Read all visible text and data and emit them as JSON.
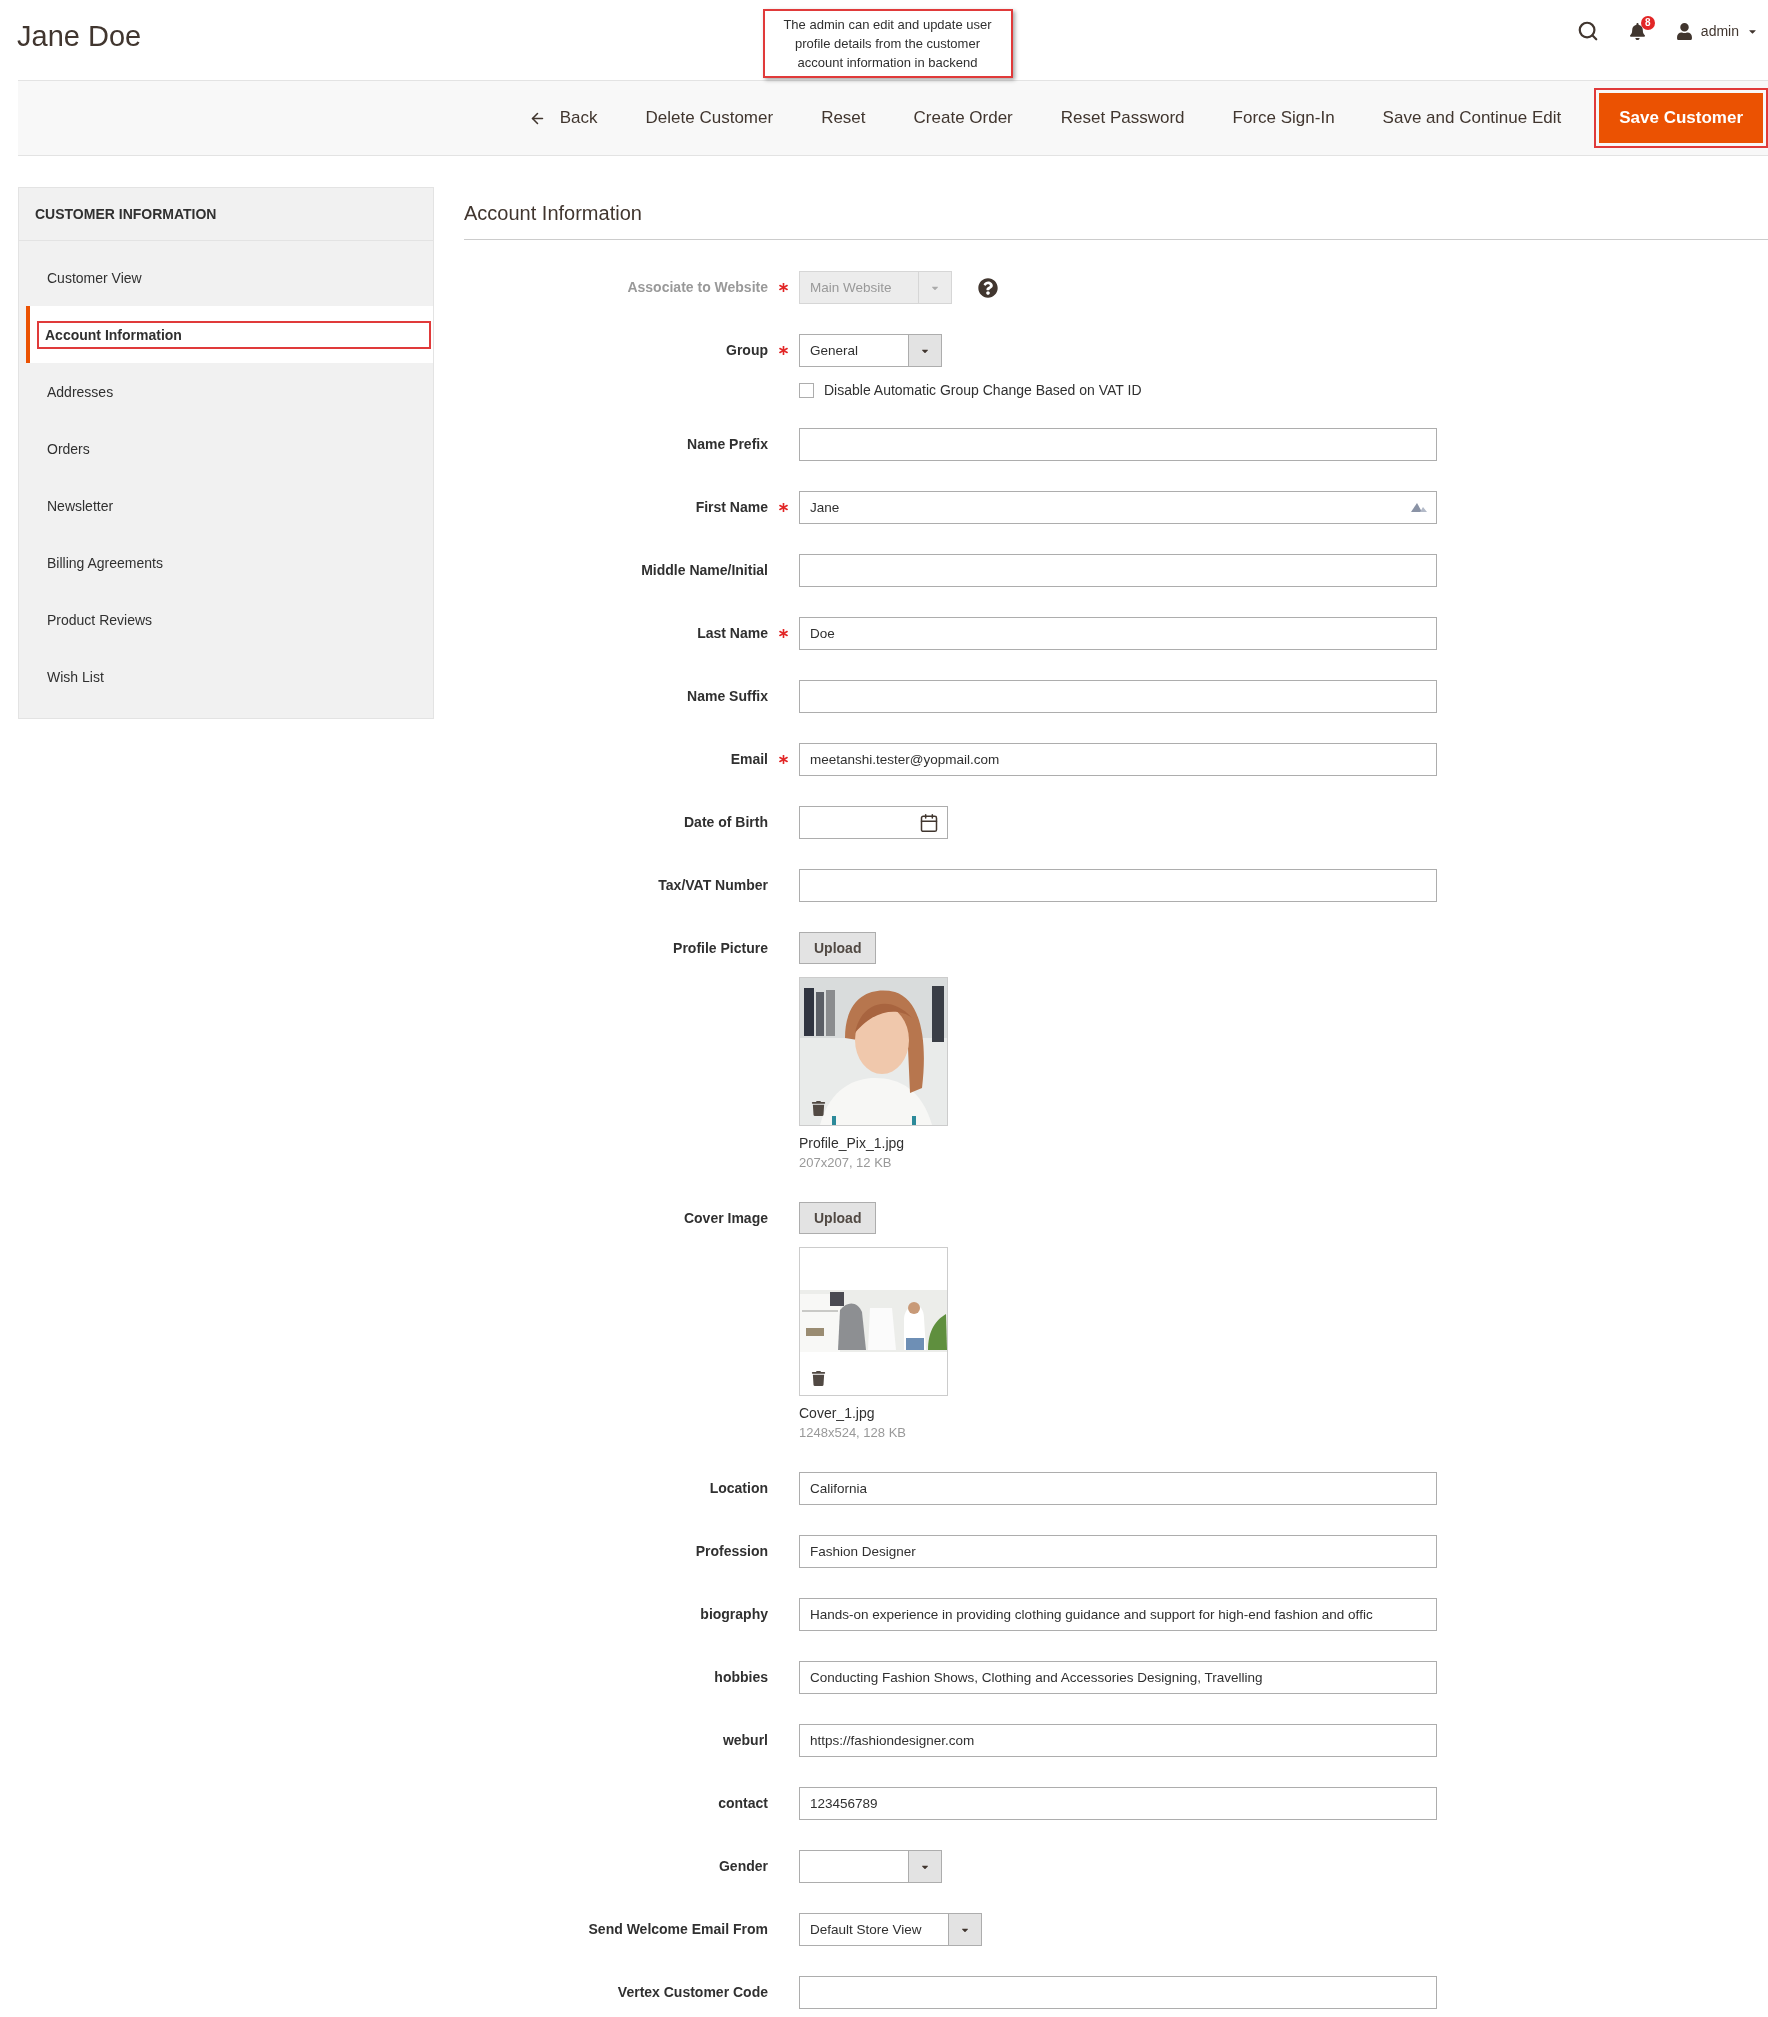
{
  "header": {
    "title": "Jane Doe",
    "annotation": "The admin can edit and update user profile details from the customer account information in backend",
    "notifications": "8",
    "user": "admin"
  },
  "toolbar": {
    "buttons": [
      {
        "label": "Back",
        "kind": "back",
        "annotated": false
      },
      {
        "label": "Delete Customer",
        "kind": "plain",
        "annotated": false
      },
      {
        "label": "Reset",
        "kind": "plain",
        "annotated": false
      },
      {
        "label": "Create Order",
        "kind": "plain",
        "annotated": false
      },
      {
        "label": "Reset Password",
        "kind": "plain",
        "annotated": false
      },
      {
        "label": "Force Sign-In",
        "kind": "plain",
        "annotated": false
      },
      {
        "label": "Save and Continue Edit",
        "kind": "plain",
        "annotated": false
      },
      {
        "label": "Save Customer",
        "kind": "primary",
        "annotated": true
      }
    ]
  },
  "sidebar": {
    "title": "CUSTOMER INFORMATION",
    "items": [
      {
        "label": "Customer View",
        "selected": false,
        "annotated": false
      },
      {
        "label": "Account Information",
        "selected": true,
        "annotated": true
      },
      {
        "label": "Addresses",
        "selected": false,
        "annotated": false
      },
      {
        "label": "Orders",
        "selected": false,
        "annotated": false
      },
      {
        "label": "Newsletter",
        "selected": false,
        "annotated": false
      },
      {
        "label": "Billing Agreements",
        "selected": false,
        "annotated": false
      },
      {
        "label": "Product Reviews",
        "selected": false,
        "annotated": false
      },
      {
        "label": "Wish List",
        "selected": false,
        "annotated": false
      }
    ]
  },
  "section": {
    "title": "Account Information"
  },
  "form": {
    "rows": [
      {
        "kind": "select",
        "label": "Associate to Website",
        "required": true,
        "disabled": true,
        "value": "Main Website",
        "help": true
      },
      {
        "kind": "select",
        "label": "Group",
        "required": true,
        "disabled": false,
        "value": "General",
        "help": false
      },
      {
        "kind": "checkbox",
        "label": "Disable Automatic Group Change Based on VAT ID",
        "checked": false
      },
      {
        "kind": "text",
        "label": "Name Prefix",
        "required": false,
        "autofill": false
      },
      {
        "kind": "text",
        "label": "First Name",
        "required": true,
        "value": "Jane",
        "autofill": true
      },
      {
        "kind": "text",
        "label": "Middle Name/Initial",
        "required": false,
        "autofill": false
      },
      {
        "kind": "text",
        "label": "Last Name",
        "required": true,
        "value": "Doe",
        "autofill": false
      },
      {
        "kind": "text",
        "label": "Name Suffix",
        "required": false,
        "autofill": false
      },
      {
        "kind": "text",
        "label": "Email",
        "required": true,
        "value": "meetanshi.tester@yopmail.com",
        "autofill": false
      },
      {
        "kind": "date",
        "label": "Date of Birth",
        "required": false
      },
      {
        "kind": "text",
        "label": "Tax/VAT Number",
        "required": false,
        "autofill": false
      },
      {
        "kind": "upload",
        "label": "Profile Picture",
        "button": "Upload",
        "file_name": "Profile_Pix_1.jpg",
        "file_size": "207x207, 12 KB"
      },
      {
        "kind": "upload",
        "label": "Cover Image",
        "button": "Upload",
        "file_name": "Cover_1.jpg",
        "file_size": "1248x524, 128 KB"
      },
      {
        "kind": "text",
        "label": "Location",
        "required": false,
        "value": "California",
        "autofill": false
      },
      {
        "kind": "text",
        "label": "Profession",
        "required": false,
        "value": "Fashion Designer",
        "autofill": false
      },
      {
        "kind": "text",
        "label": "biography",
        "required": false,
        "value": "Hands-on experience in providing clothing guidance and support for high-end fashion and offic",
        "autofill": false
      },
      {
        "kind": "text",
        "label": "hobbies",
        "required": false,
        "value": "Conducting Fashion Shows, Clothing and Accessories Designing, Travelling",
        "autofill": false
      },
      {
        "kind": "text",
        "label": "weburl",
        "required": false,
        "value": "https://fashiondesigner.com",
        "autofill": false
      },
      {
        "kind": "text",
        "label": "contact",
        "required": false,
        "value": "123456789",
        "autofill": false
      },
      {
        "kind": "select",
        "label": "Gender",
        "required": false,
        "disabled": false,
        "help": false
      },
      {
        "kind": "select",
        "label": "Send Welcome Email From",
        "required": false,
        "disabled": false,
        "value": "Default Store View",
        "help": false
      },
      {
        "kind": "text",
        "label": "Vertex Customer Code",
        "required": false,
        "autofill": false
      }
    ]
  }
}
